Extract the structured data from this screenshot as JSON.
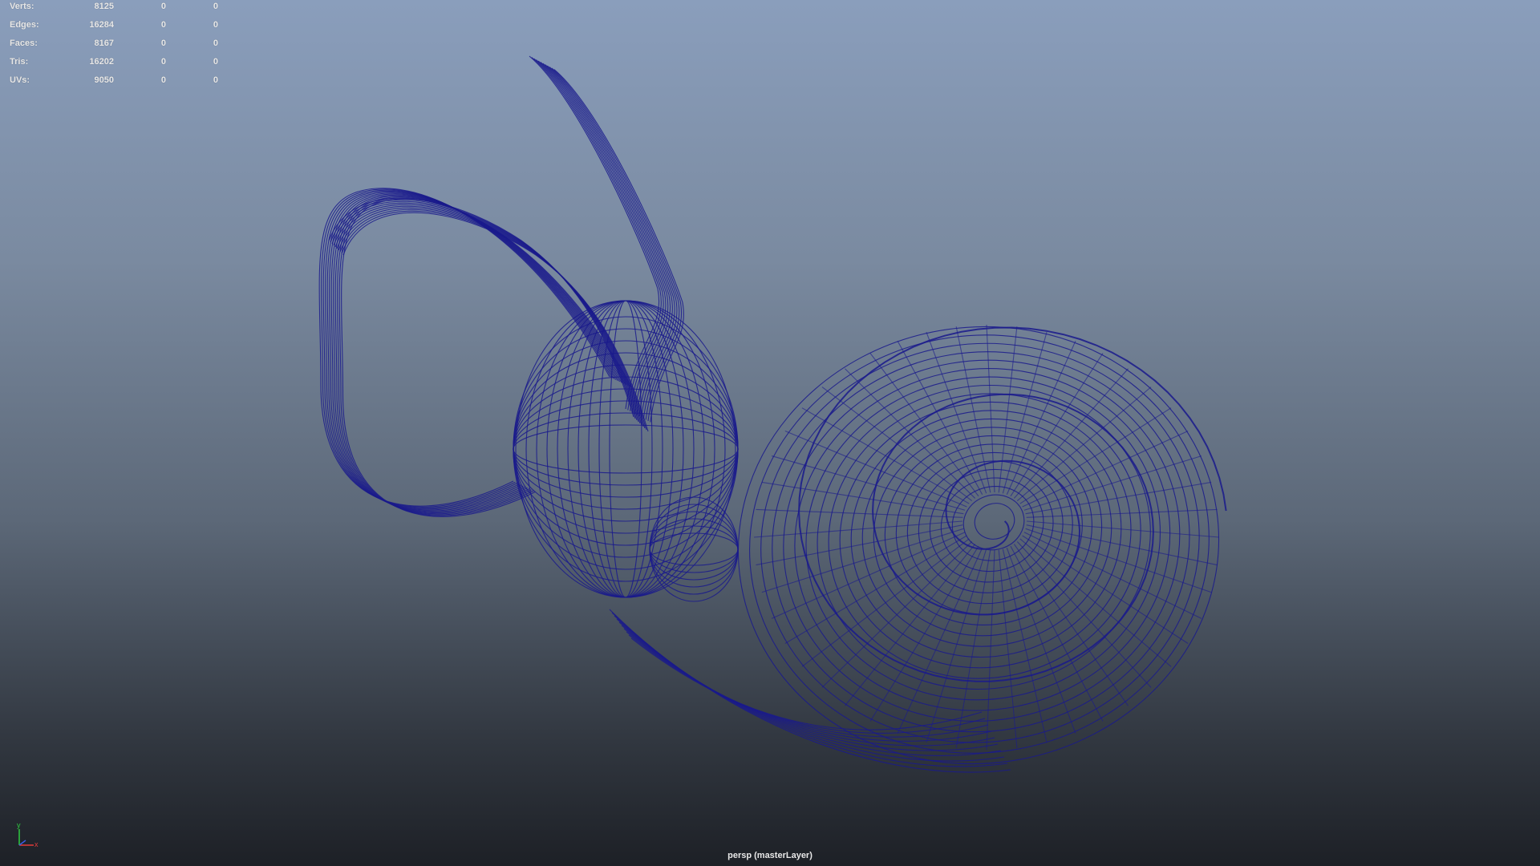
{
  "hud": {
    "rows": [
      {
        "label": "Verts:",
        "total": "8125",
        "selected": "0",
        "component": "0"
      },
      {
        "label": "Edges:",
        "total": "16284",
        "selected": "0",
        "component": "0"
      },
      {
        "label": "Faces:",
        "total": "8167",
        "selected": "0",
        "component": "0"
      },
      {
        "label": "Tris:",
        "total": "16202",
        "selected": "0",
        "component": "0"
      },
      {
        "label": "UVs:",
        "total": "9050",
        "selected": "0",
        "component": "0"
      }
    ]
  },
  "viewport": {
    "camera_label": "persp (masterLayer)",
    "wireframe_color": "#1a1a8c",
    "object": "inner-ear-wireframe"
  },
  "axis_indicator": {
    "y_label": "y",
    "x_label": "x",
    "y_color": "#2ecc40",
    "x_color": "#e23b3b",
    "z_color": "#3b5be2"
  }
}
